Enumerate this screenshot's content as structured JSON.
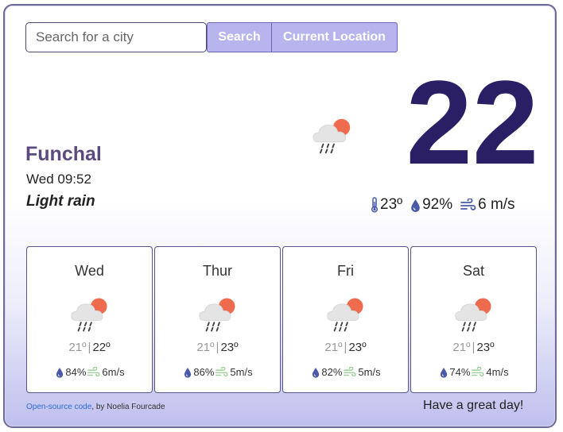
{
  "search": {
    "placeholder": "Search for a city",
    "value": "",
    "search_label": "Search",
    "location_label": "Current Location"
  },
  "current": {
    "city": "Funchal",
    "datetime": "Wed 09:52",
    "description": "Light rain",
    "temperature": "22",
    "feels_like": "23º",
    "humidity": "92%",
    "wind": "6 m/s",
    "icon": "rain-cloud-sun-icon"
  },
  "forecast": [
    {
      "day": "Wed",
      "min": "21º",
      "max": "22º",
      "humidity": "84%",
      "wind": "6m/s",
      "icon": "rain-cloud-sun-icon"
    },
    {
      "day": "Thur",
      "min": "21º",
      "max": "23º",
      "humidity": "86%",
      "wind": "5m/s",
      "icon": "rain-cloud-sun-icon"
    },
    {
      "day": "Fri",
      "min": "21º",
      "max": "23º",
      "humidity": "82%",
      "wind": "5m/s",
      "icon": "rain-cloud-sun-icon"
    },
    {
      "day": "Sat",
      "min": "21º",
      "max": "23º",
      "humidity": "74%",
      "wind": "4m/s",
      "icon": "rain-cloud-sun-icon"
    }
  ],
  "footer": {
    "source_link": "Open-source code",
    "author": ", by Noelia Fourcade",
    "greeting": "Have a great day!"
  },
  "colors": {
    "accent_button": "#b8b5ee",
    "temperature": "#2a1e64",
    "city": "#5b4a7e",
    "sun": "#ee6c4d",
    "cloud": "#e6e6e6",
    "humidity_drop": "#4a5aa8",
    "wind": "#9cd19c",
    "link": "#2b6fd6"
  }
}
